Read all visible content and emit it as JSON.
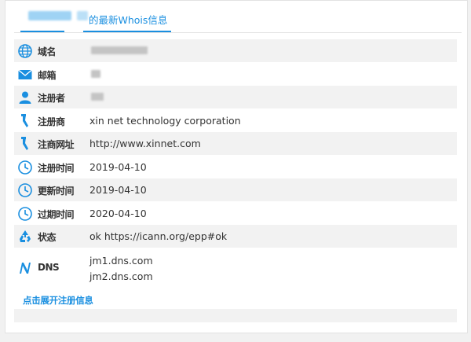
{
  "tab": {
    "title_suffix": "的最新Whois信息",
    "accent_color": "#1a8fe0"
  },
  "rows": [
    {
      "icon": "globe-icon",
      "label": "域名",
      "value": "",
      "redacted": true
    },
    {
      "icon": "mail-icon",
      "label": "邮箱",
      "value": "",
      "redacted": true
    },
    {
      "icon": "user-icon",
      "label": "注册者",
      "value": "",
      "redacted": true
    },
    {
      "icon": "registrar-icon",
      "label": "注册商",
      "value": "xin net technology corporation"
    },
    {
      "icon": "registrar-icon",
      "label": "注商网址",
      "value": "http://www.xinnet.com"
    },
    {
      "icon": "clock-icon",
      "label": "注册时间",
      "value": "2019-04-10"
    },
    {
      "icon": "clock-icon",
      "label": "更新时间",
      "value": "2019-04-10"
    },
    {
      "icon": "clock-icon",
      "label": "过期时间",
      "value": "2020-04-10"
    },
    {
      "icon": "recycle-icon",
      "label": "状态",
      "value": "ok https://icann.org/epp#ok"
    },
    {
      "icon": "dns-icon",
      "label": "DNS",
      "values": [
        "jm1.dns.com",
        "jm2.dns.com"
      ]
    }
  ],
  "expand_link": "点击展开注册信息"
}
